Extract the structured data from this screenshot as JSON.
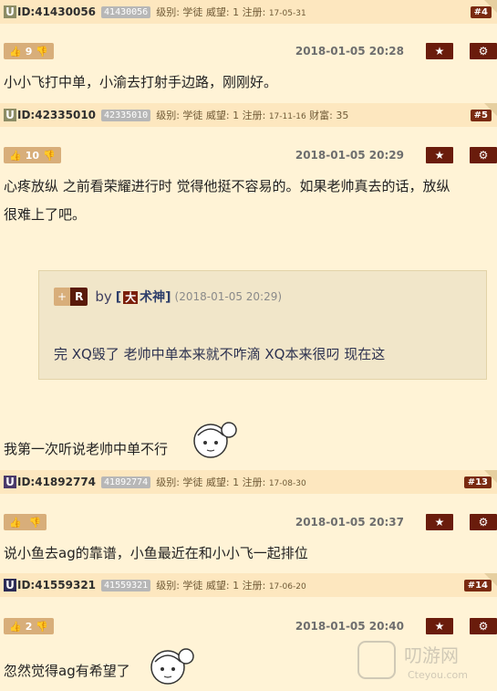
{
  "posts": [
    {
      "uid": "ID:41430056",
      "uid_tag": "41430056",
      "meta_prefix": "级别: 学徒 威望: 1 注册:",
      "reg_date": "17-05-31",
      "floor": "#4",
      "votes": "9",
      "timestamp": "2018-01-05 20:28",
      "content": "小小飞打中单，小渝去打射手边路，刚刚好。"
    },
    {
      "uid": "ID:42335010",
      "uid_tag": "42335010",
      "meta_prefix": "级别: 学徒 威望: 1 注册:",
      "reg_date": "17-11-16",
      "wealth_label": "财富:",
      "wealth": "35",
      "floor": "#5",
      "votes": "10",
      "timestamp": "2018-01-05 20:29",
      "content_line1": "心疼放纵 之前看荣耀进行时 觉得他挺不容易的。如果老帅真去的话，放纵",
      "content_line2": "很难上了吧。",
      "quote": {
        "plus": "+",
        "r": "R",
        "by": "by",
        "bracket_open": "[",
        "badge": "大",
        "title": "术神]",
        "timestamp": "(2018-01-05 20:29)",
        "body": "完 XQ毁了 老帅中单本来就不咋滴 XQ本来很叼 现在这"
      },
      "reply": "我第一次听说老帅中单不行"
    },
    {
      "uid": "ID:41892774",
      "uid_tag": "41892774",
      "meta_prefix": "级别: 学徒 威望: 1 注册:",
      "reg_date": "17-08-30",
      "floor": "#13",
      "votes": "",
      "timestamp": "2018-01-05 20:37",
      "content": "说小鱼去ag的靠谱，小鱼最近在和小小飞一起排位"
    },
    {
      "uid": "ID:41559321",
      "uid_tag": "41559321",
      "meta_prefix": "级别: 学徒 威望: 1 注册:",
      "reg_date": "17-06-20",
      "floor": "#14",
      "votes": "2",
      "timestamp": "2018-01-05 20:40",
      "content": "忽然觉得ag有希望了"
    }
  ],
  "watermark": {
    "line1": "叨游网",
    "line2": "Cteyou.com"
  },
  "icons": {
    "star": "star-icon",
    "gear": "gear-icon",
    "thumbs_up": "thumbs-up-icon",
    "thumbs_down": "thumbs-down-icon"
  },
  "colors": {
    "bg": "#fff3d6",
    "bar": "#fde7bf",
    "button": "#6a1c0c",
    "vote": "#d8ae7a"
  }
}
